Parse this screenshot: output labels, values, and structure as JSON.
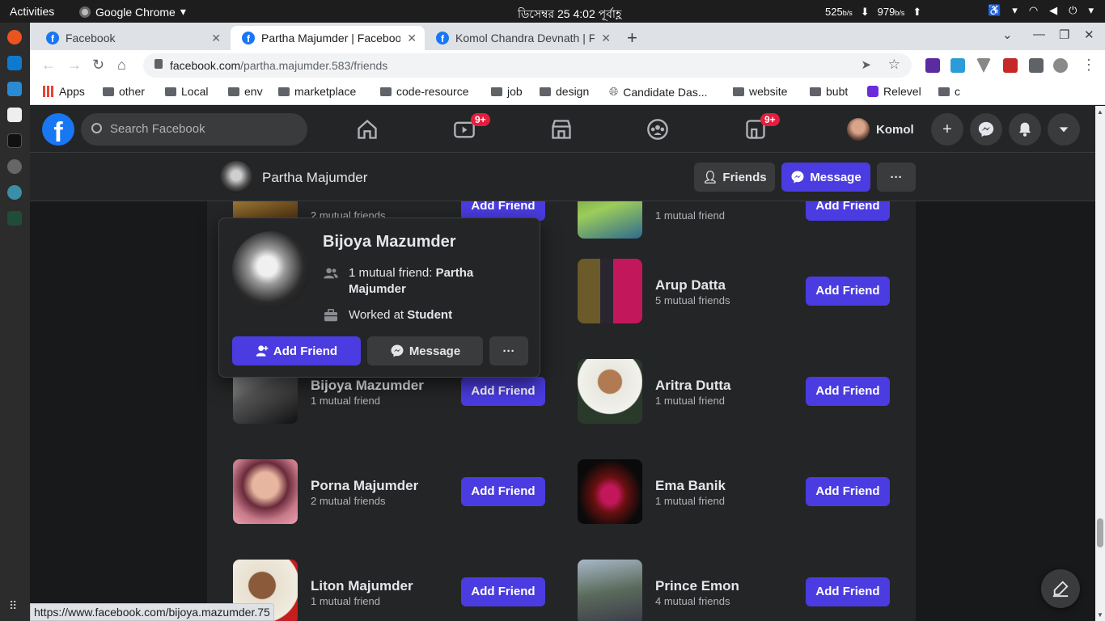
{
  "system_bar": {
    "activities": "Activities",
    "app_name": "Google Chrome",
    "clock": "ডিসেম্বর 25   4:02 পূর্বাহ্ণ",
    "net_down": "525",
    "net_up": "979",
    "net_unit": "b/s"
  },
  "browser": {
    "tabs": [
      {
        "title": "Facebook",
        "active": false
      },
      {
        "title": "Partha Majumder | Facebook",
        "active": true
      },
      {
        "title": "Komol Chandra Devnath | Facebook",
        "active": false
      }
    ],
    "url_host": "facebook.com",
    "url_path": "/partha.majumder.583/friends",
    "bookmarks": [
      "Apps",
      "other",
      "Local",
      "env",
      "marketplace",
      "code-resource",
      "job",
      "design",
      "Candidate Das...",
      "website",
      "bubt",
      "Relevel",
      "c"
    ],
    "status_url": "https://www.facebook.com/bijoya.mazumder.75"
  },
  "fb_nav": {
    "search_placeholder": "Search Facebook",
    "watch_badge": "9+",
    "gaming_badge": "9+",
    "user_name": "Komol"
  },
  "profile_header": {
    "name": "Partha Majumder",
    "friends_label": "Friends",
    "message_label": "Message",
    "more_label": "···"
  },
  "friends": [
    {
      "name": "",
      "mutual": "2 mutual friends",
      "button": "Add Friend"
    },
    {
      "name": "",
      "mutual": "1 mutual friend",
      "button": "Add Friend"
    },
    {
      "name": "Arup Datta",
      "mutual": "5 mutual friends",
      "button": "Add Friend"
    },
    {
      "name": "Bijoya Mazumder",
      "mutual": "1 mutual friend",
      "button": "Add Friend"
    },
    {
      "name": "Aritra Dutta",
      "mutual": "1 mutual friend",
      "button": "Add Friend"
    },
    {
      "name": "Porna Majumder",
      "mutual": "2 mutual friends",
      "button": "Add Friend"
    },
    {
      "name": "Ema Banik",
      "mutual": "1 mutual friend",
      "button": "Add Friend"
    },
    {
      "name": "Liton Majumder",
      "mutual": "1 mutual friend",
      "button": "Add Friend"
    },
    {
      "name": "Prince Emon",
      "mutual": "4 mutual friends",
      "button": "Add Friend"
    }
  ],
  "hover_card": {
    "name": "Bijoya Mazumder",
    "mutual_prefix": "1 mutual friend: ",
    "mutual_name": "Partha Majumder",
    "work_prefix": "Worked at ",
    "work_place": "Student",
    "add_friend_label": "Add Friend",
    "message_label": "Message",
    "more_label": "···"
  },
  "colors": {
    "fb_blue": "#1877f2",
    "button_purple": "#4a3ce0",
    "badge_red": "#e41e3f",
    "dark_bg": "#18191a",
    "card_bg": "#242526"
  }
}
